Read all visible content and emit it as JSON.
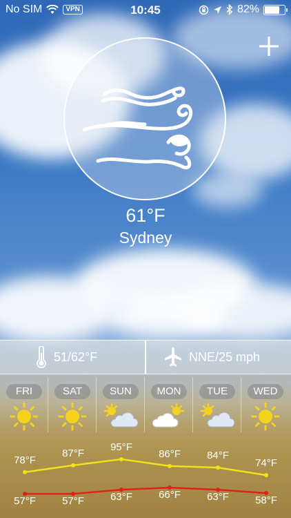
{
  "status": {
    "carrier": "No SIM",
    "vpn": "VPN",
    "time": "10:45",
    "battery_text": "82%",
    "battery_level": 0.82
  },
  "add_button": {
    "icon": "plus-icon"
  },
  "current": {
    "condition_icon": "windy-icon",
    "temperature": "61°F",
    "city": "Sydney"
  },
  "info": {
    "range_icon": "thermometer-icon",
    "range": "51/62°F",
    "wind_icon": "plane-icon",
    "wind": "NNE/25 mph"
  },
  "forecast": [
    {
      "day": "FRI",
      "icon": "sunny-icon",
      "high": "78°F",
      "low": "57°F",
      "high_value": 78,
      "low_value": 57
    },
    {
      "day": "SAT",
      "icon": "sunny-icon",
      "high": "87°F",
      "low": "57°F",
      "high_value": 87,
      "low_value": 57
    },
    {
      "day": "SUN",
      "icon": "partly-cloudy-icon",
      "high": "95°F",
      "low": "63°F",
      "high_value": 95,
      "low_value": 63
    },
    {
      "day": "MON",
      "icon": "partly-cloudy-icon",
      "high": "86°F",
      "low": "66°F",
      "high_value": 86,
      "low_value": 66
    },
    {
      "day": "TUE",
      "icon": "partly-cloudy-icon",
      "high": "84°F",
      "low": "63°F",
      "high_value": 84,
      "low_value": 63
    },
    {
      "day": "WED",
      "icon": "sunny-icon",
      "high": "74°F",
      "low": "58°F",
      "high_value": 74,
      "low_value": 58
    }
  ],
  "colors": {
    "high_line": "#f2e21a",
    "low_line": "#e0201a",
    "sun": "#f5d21c"
  }
}
